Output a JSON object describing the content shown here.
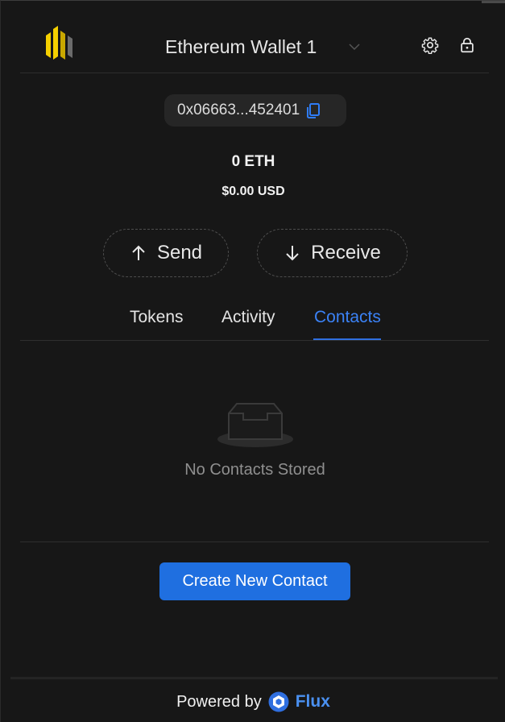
{
  "header": {
    "wallet_name": "Ethereum Wallet 1",
    "logo_icon": "flux-bars-logo",
    "settings_icon": "gear-icon",
    "lock_icon": "lock-icon",
    "dropdown_icon": "chevron-down-icon"
  },
  "account": {
    "address": "0x06663...452401",
    "copy_icon": "copy-icon"
  },
  "balance": {
    "eth": "0 ETH",
    "usd": "$0.00 USD"
  },
  "actions": {
    "send_label": "Send",
    "receive_label": "Receive"
  },
  "tabs": [
    {
      "label": "Tokens",
      "active": false
    },
    {
      "label": "Activity",
      "active": false
    },
    {
      "label": "Contacts",
      "active": true
    }
  ],
  "contacts": {
    "empty_message": "No Contacts Stored",
    "create_label": "Create New Contact"
  },
  "footer": {
    "powered_by": "Powered by",
    "brand": "Flux"
  },
  "colors": {
    "background": "#171717",
    "accent": "#1f6fe0",
    "active_tab": "#3b82f6",
    "logo_yellow": "#f5d000"
  }
}
